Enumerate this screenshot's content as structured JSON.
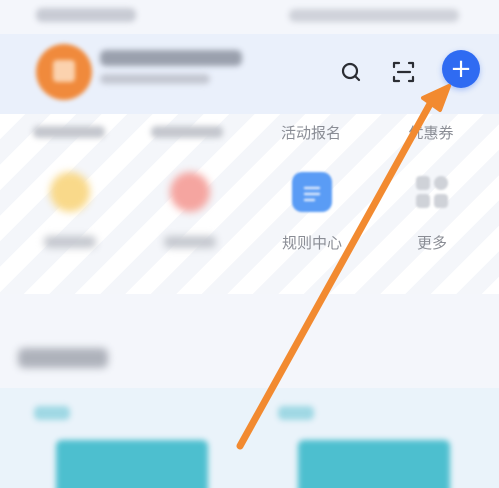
{
  "header": {
    "icons": {
      "search": "search-icon",
      "scan": "scan-icon",
      "add": "plus-icon"
    },
    "add_symbol": "+"
  },
  "tabs": [
    {
      "label": "活动报名"
    },
    {
      "label": "优惠券"
    }
  ],
  "grid": [
    {
      "label": "规则中心",
      "icon": "document-icon"
    },
    {
      "label": "更多",
      "icon": "grid-icon"
    }
  ],
  "colors": {
    "accent": "#2f6bf2",
    "arrow": "#f28a30",
    "rules_icon": "#5a9cf5",
    "more_icon": "#d3d6dc"
  }
}
